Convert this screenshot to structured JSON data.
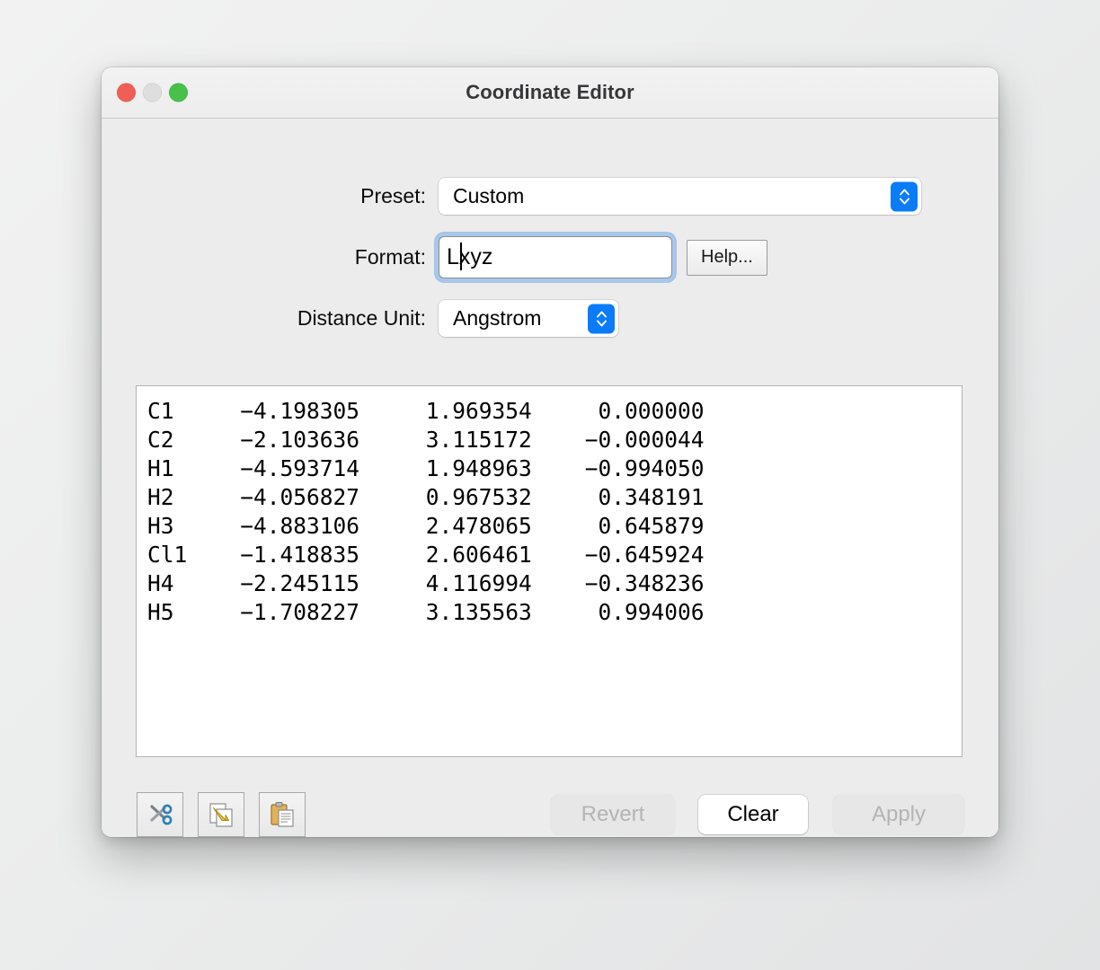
{
  "window": {
    "title": "Coordinate Editor",
    "traffic_lights": [
      {
        "name": "close",
        "color": "#f05f56"
      },
      {
        "name": "minimize",
        "color": "#dedede"
      },
      {
        "name": "maximize",
        "color": "#47c14a"
      }
    ]
  },
  "form": {
    "preset": {
      "label": "Preset:",
      "value": "Custom",
      "stepper_color": "#0a7cf7"
    },
    "format": {
      "label": "Format:",
      "value": "Lxyz",
      "placeholder": "",
      "focused": true,
      "caret_after_chars": 1,
      "help_button": "Help..."
    },
    "distance_unit": {
      "label": "Distance Unit:",
      "value": "Angstrom",
      "stepper_color": "#0a7cf7"
    }
  },
  "editor": {
    "columns": [
      "label",
      "x",
      "y",
      "z"
    ],
    "rows": [
      {
        "label": "C1",
        "x": "−4.198305",
        "y": "1.969354",
        "z": "0.000000"
      },
      {
        "label": "C2",
        "x": "−2.103636",
        "y": "3.115172",
        "z": "−0.000044"
      },
      {
        "label": "H1",
        "x": "−4.593714",
        "y": "1.948963",
        "z": "−0.994050"
      },
      {
        "label": "H2",
        "x": "−4.056827",
        "y": "0.967532",
        "z": "0.348191"
      },
      {
        "label": "H3",
        "x": "−4.883106",
        "y": "2.478065",
        "z": "0.645879"
      },
      {
        "label": "Cl1",
        "x": "−1.418835",
        "y": "2.606461",
        "z": "−0.645924"
      },
      {
        "label": "H4",
        "x": "−2.245115",
        "y": "4.116994",
        "z": "−0.348236"
      },
      {
        "label": "H5",
        "x": "−1.708227",
        "y": "3.135563",
        "z": "0.994006"
      }
    ],
    "text": "C1     −4.198305     1.969354     0.000000\nC2     −2.103636     3.115172    −0.000044\nH1     −4.593714     1.948963    −0.994050\nH2     −4.056827     0.967532     0.348191\nH3     −4.883106     2.478065     0.645879\nCl1    −1.418835     2.606461    −0.645924\nH4     −2.245115     4.116994    −0.348236\nH5     −1.708227     3.135563     0.994006"
  },
  "toolbar": {
    "cut": "cut-icon",
    "copy": "copy-icon",
    "paste": "paste-icon"
  },
  "actions": {
    "revert": {
      "label": "Revert",
      "enabled": false
    },
    "clear": {
      "label": "Clear",
      "enabled": true
    },
    "apply": {
      "label": "Apply",
      "enabled": false
    }
  }
}
